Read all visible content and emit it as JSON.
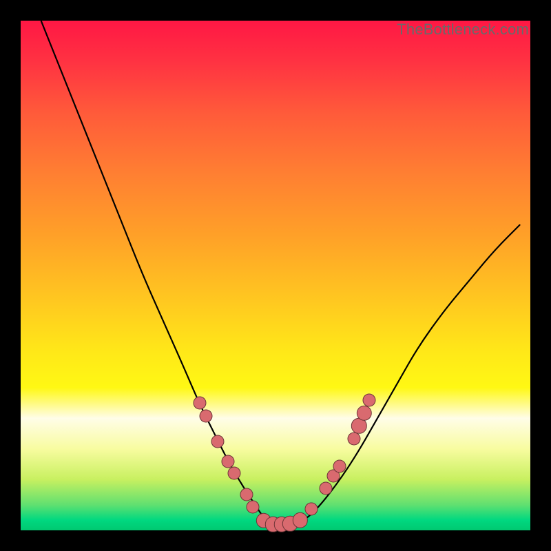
{
  "watermark": "TheBottleneck.com",
  "colors": {
    "background": "#000000",
    "curve": "#000000",
    "dot_fill": "#d96a6f",
    "dot_stroke": "rgba(0,0,0,0.5)"
  },
  "chart_data": {
    "type": "line",
    "title": "",
    "xlabel": "",
    "ylabel": "",
    "xlim": [
      0,
      100
    ],
    "ylim": [
      0,
      100
    ],
    "grid": false,
    "legend": false,
    "series": [
      {
        "name": "bottleneck-curve",
        "x": [
          4,
          8,
          12,
          16,
          20,
          24,
          28,
          32,
          35,
          38,
          41,
          44,
          46,
          48,
          50,
          52,
          55,
          58,
          62,
          66,
          70,
          74,
          78,
          83,
          88,
          93,
          98
        ],
        "y": [
          100,
          90,
          80,
          70,
          60,
          50,
          41,
          32,
          25,
          19,
          13,
          8,
          5,
          2,
          0.5,
          0.5,
          1.5,
          4,
          9,
          15,
          22,
          29,
          36,
          43,
          49,
          55,
          60
        ]
      }
    ],
    "markers": [
      {
        "x": 35.2,
        "y": 25.0,
        "r": 10
      },
      {
        "x": 36.3,
        "y": 22.5,
        "r": 10
      },
      {
        "x": 38.6,
        "y": 17.5,
        "r": 10
      },
      {
        "x": 40.7,
        "y": 13.5,
        "r": 10
      },
      {
        "x": 41.9,
        "y": 11.2,
        "r": 10
      },
      {
        "x": 44.3,
        "y": 7.0,
        "r": 10
      },
      {
        "x": 45.5,
        "y": 4.6,
        "r": 10
      },
      {
        "x": 47.7,
        "y": 1.9,
        "r": 12
      },
      {
        "x": 49.5,
        "y": 1.2,
        "r": 12
      },
      {
        "x": 51.2,
        "y": 1.2,
        "r": 12
      },
      {
        "x": 52.9,
        "y": 1.3,
        "r": 12
      },
      {
        "x": 54.8,
        "y": 2.0,
        "r": 12
      },
      {
        "x": 57.0,
        "y": 4.2,
        "r": 10
      },
      {
        "x": 59.8,
        "y": 8.2,
        "r": 10
      },
      {
        "x": 61.4,
        "y": 10.7,
        "r": 10
      },
      {
        "x": 62.5,
        "y": 12.6,
        "r": 10
      },
      {
        "x": 65.4,
        "y": 18.0,
        "r": 10
      },
      {
        "x": 66.4,
        "y": 20.5,
        "r": 12
      },
      {
        "x": 67.4,
        "y": 23.0,
        "r": 12
      },
      {
        "x": 68.4,
        "y": 25.5,
        "r": 10
      }
    ]
  }
}
